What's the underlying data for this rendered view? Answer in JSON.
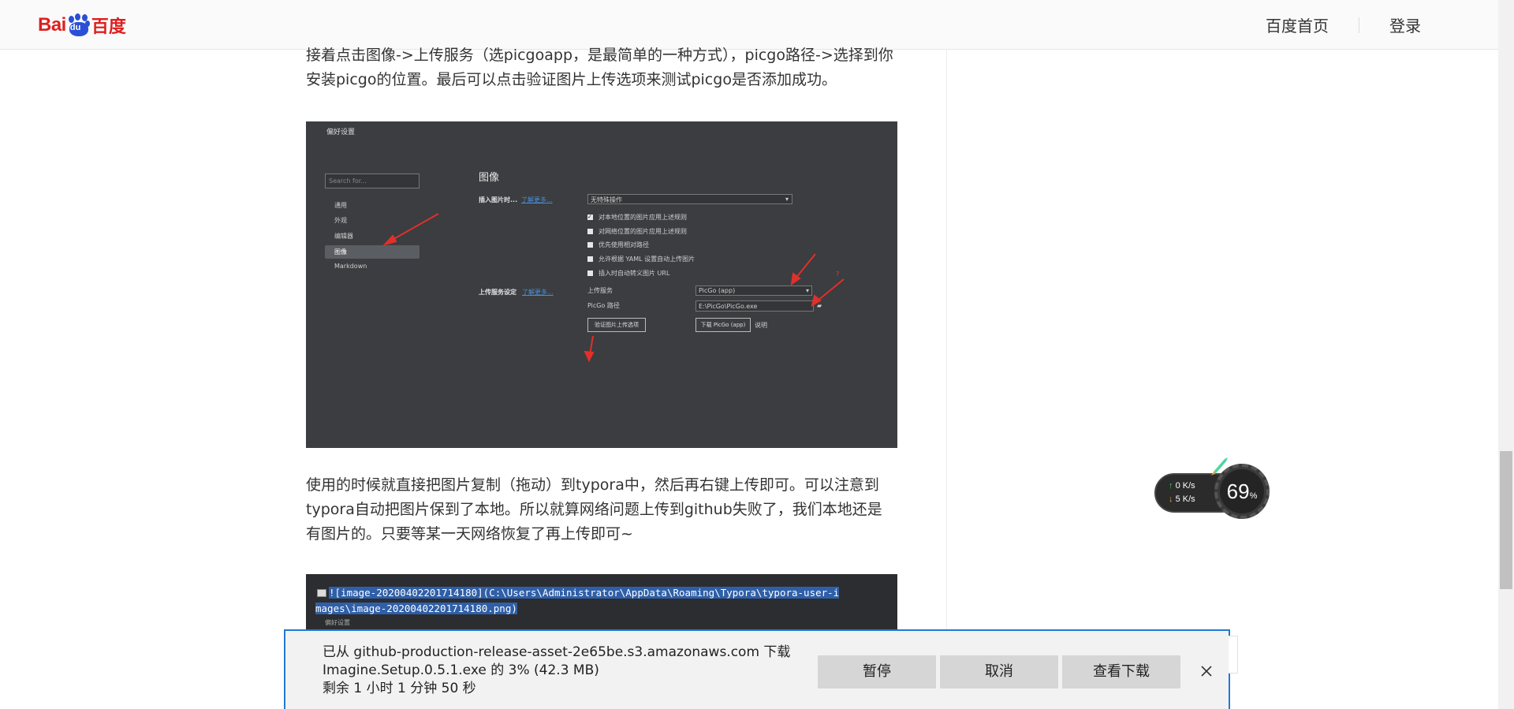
{
  "header": {
    "logo_text": "Bai百度",
    "logo_left": "Bai",
    "logo_paw": "du",
    "logo_right": "百度",
    "nav": [
      {
        "label": "百度首页"
      },
      {
        "label": "登录"
      }
    ]
  },
  "article": {
    "paragraph1": "接着点击图像->上传服务（选picgoapp，是最简单的一种方式），picgo路径->选择到你安装picgo的位置。最后可以点击验证图片上传选项来测试picgo是否添加成功。",
    "screenshot1": {
      "window_title": "偏好设置",
      "search_placeholder": "Search for...",
      "menu": [
        "通用",
        "外观",
        "编辑器",
        "图像",
        "Markdown"
      ],
      "selected_menu": "图像",
      "section_title": "图像",
      "insert_label": "插入图片时...",
      "learn_more": "了解更多...",
      "insert_select": "无特殊操作",
      "options": [
        {
          "label": "对本地位置的图片应用上述规则",
          "checked": true
        },
        {
          "label": "对网络位置的图片应用上述规则",
          "checked": false
        },
        {
          "label": "优先使用相对路径",
          "checked": false
        },
        {
          "label": "允许根据 YAML 设置自动上传图片",
          "checked": false
        },
        {
          "label": "插入时自动转义图片 URL",
          "checked": false
        }
      ],
      "upload_label": "上传服务设定",
      "upload_service_label": "上传服务",
      "upload_service_value": "PicGo (app)",
      "picgo_path_label": "PicGo 路径",
      "picgo_path_value": "E:\\PicGo\\PicGo.exe",
      "verify_button": "验证图片上传选项",
      "download_button": "下载 PicGo (app)",
      "help_link": "说明",
      "help_icon": "?"
    },
    "paragraph2": "使用的时候就直接把图片复制（拖动）到typora中，然后再右键上传即可。可以注意到typora自动把图片保到了本地。所以就算网络问题上传到github失败了，我们本地还是有图片的。只要等某一天网络恢复了再上传即可~",
    "code": {
      "line1": "![image-20200402201714180](C:\\Users\\Administrator\\AppData\\Roaming\\Typora\\typora-user-i",
      "line2": "mages\\image-20200402201714180.png)",
      "sub": "偏好设置"
    }
  },
  "widget": {
    "upload_rate": "0  K/s",
    "download_rate": "5  K/s",
    "percent": "69",
    "percent_unit": "%"
  },
  "download_bar": {
    "line1": "已从 github-production-release-asset-2e65be.s3.amazonaws.com 下载",
    "line2": "Imagine.Setup.0.5.1.exe 的 3% (42.3 MB)",
    "line3": "剩余  1 小时 1 分钟 50 秒",
    "progress_percent": 3,
    "buttons": {
      "pause": "暂停",
      "cancel": "取消",
      "view": "查看下载"
    }
  },
  "colors": {
    "logo_red": "#de1f1f",
    "logo_blue": "#2a4fd6",
    "accent_blue": "#1f7ad4",
    "code_highlight": "#2f5fa8"
  }
}
